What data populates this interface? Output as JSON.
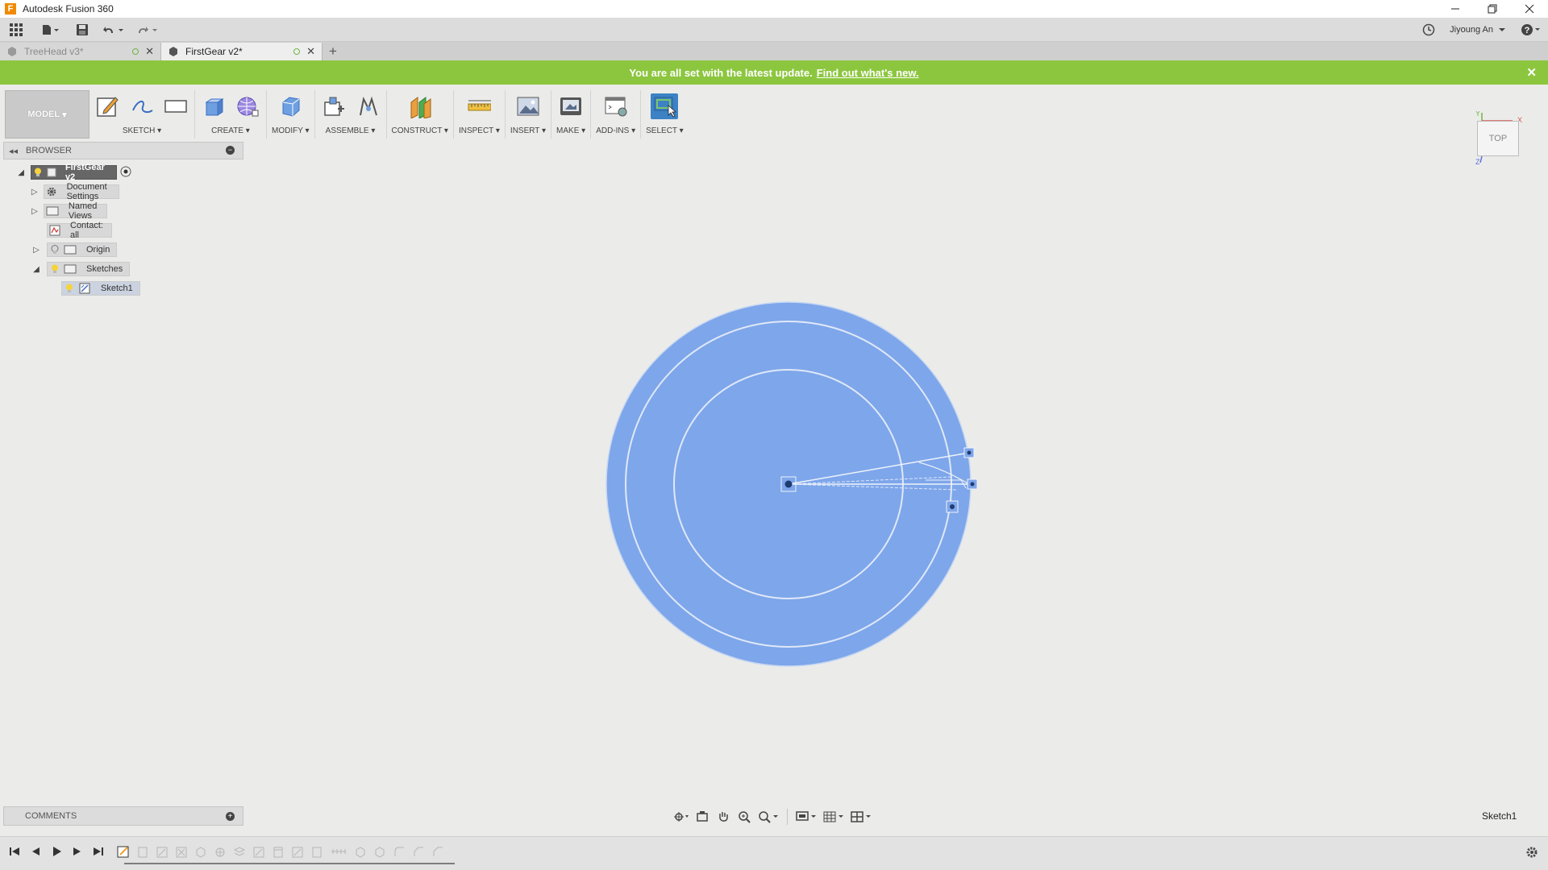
{
  "window": {
    "title": "Autodesk Fusion 360",
    "logo_letter": "F"
  },
  "quick_access": {
    "user_name": "Jiyoung An"
  },
  "tabs": [
    {
      "label": "TreeHead v3*",
      "active": false
    },
    {
      "label": "FirstGear v2*",
      "active": true
    }
  ],
  "notification": {
    "message": "You are all set with the latest update.",
    "link": "Find out what's new."
  },
  "toolbar": {
    "workspace": "MODEL",
    "groups": {
      "sketch": "SKETCH",
      "create": "CREATE",
      "modify": "MODIFY",
      "assemble": "ASSEMBLE",
      "construct": "CONSTRUCT",
      "inspect": "INSPECT",
      "insert": "INSERT",
      "make": "MAKE",
      "addins": "ADD-INS",
      "select": "SELECT"
    }
  },
  "browser": {
    "title": "BROWSER",
    "items": [
      {
        "label": "FirstGear v2",
        "icon": "component-icon"
      },
      {
        "label": "Document Settings",
        "icon": "gear-icon"
      },
      {
        "label": "Named Views",
        "icon": "folder-icon"
      },
      {
        "label": "Contact: all",
        "icon": "contact-icon"
      },
      {
        "label": "Origin",
        "icon": "folder-icon"
      },
      {
        "label": "Sketches",
        "icon": "folder-icon"
      },
      {
        "label": "Sketch1",
        "icon": "sketch-icon"
      }
    ]
  },
  "viewcube": {
    "face": "TOP",
    "axes": {
      "x": "X",
      "y": "Y",
      "z": "Z"
    }
  },
  "comments": {
    "title": "COMMENTS"
  },
  "status": {
    "active_sketch": "Sketch1"
  },
  "colors": {
    "notification_bg": "#8cc63f",
    "sketch_fill": "#7ea6ea",
    "select_active": "#3c82c4"
  }
}
